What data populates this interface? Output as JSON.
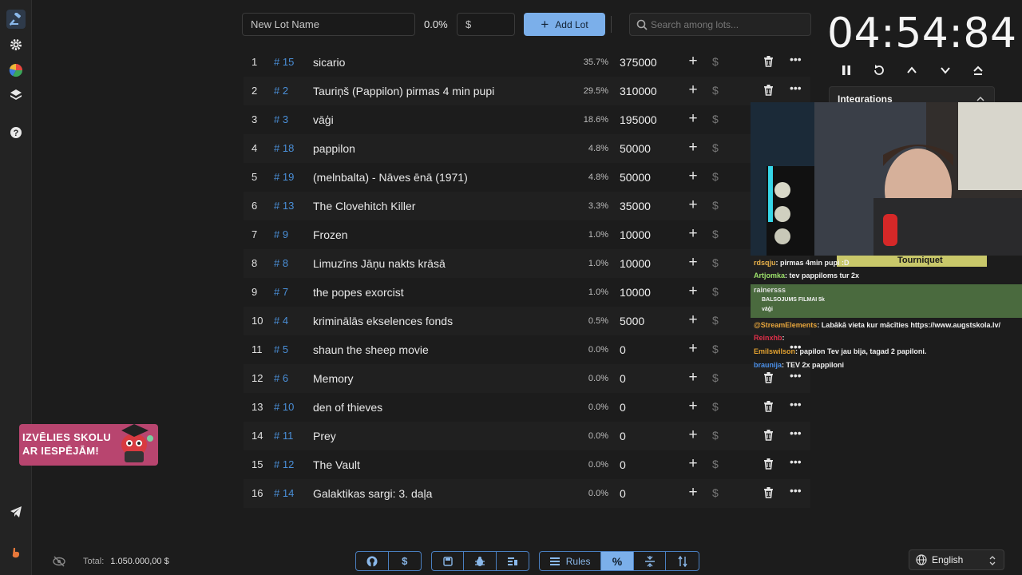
{
  "sidebar": {
    "items": [
      {
        "name": "auction-icon"
      },
      {
        "name": "gear-icon"
      },
      {
        "name": "pie-chart-icon"
      },
      {
        "name": "layers-icon"
      },
      {
        "name": "help-icon"
      }
    ],
    "bottom": [
      {
        "name": "telegram-icon"
      },
      {
        "name": "brand-icon"
      }
    ]
  },
  "promo": {
    "line1": "IZVĒLIES SKOLU",
    "line2": "AR IESPĒJĀM!"
  },
  "toolbar": {
    "name_placeholder": "New Lot Name",
    "percent": "0.0%",
    "amount_placeholder": "$",
    "add_label": "Add Lot",
    "search_placeholder": "Search among lots..."
  },
  "lots": [
    {
      "n": "1",
      "id": "# 15",
      "name": "sicario",
      "pct": "35.7%",
      "amount": "375000"
    },
    {
      "n": "2",
      "id": "# 2",
      "name": "Tauriņš (Pappilon) pirmas 4 min pupi",
      "pct": "29.5%",
      "amount": "310000"
    },
    {
      "n": "3",
      "id": "# 3",
      "name": "vāģi",
      "pct": "18.6%",
      "amount": "195000"
    },
    {
      "n": "4",
      "id": "# 18",
      "name": "pappilon",
      "pct": "4.8%",
      "amount": "50000"
    },
    {
      "n": "5",
      "id": "# 19",
      "name": "(melnbalta) - Nāves ēnā (1971)",
      "pct": "4.8%",
      "amount": "50000"
    },
    {
      "n": "6",
      "id": "# 13",
      "name": "The Clovehitch Killer",
      "pct": "3.3%",
      "amount": "35000"
    },
    {
      "n": "7",
      "id": "# 9",
      "name": "Frozen",
      "pct": "1.0%",
      "amount": "10000"
    },
    {
      "n": "8",
      "id": "# 8",
      "name": "Limuzīns Jāņu nakts krāsā",
      "pct": "1.0%",
      "amount": "10000"
    },
    {
      "n": "9",
      "id": "# 7",
      "name": "the popes exorcist",
      "pct": "1.0%",
      "amount": "10000"
    },
    {
      "n": "10",
      "id": "# 4",
      "name": "kriminālās ekselences fonds",
      "pct": "0.5%",
      "amount": "5000"
    },
    {
      "n": "11",
      "id": "# 5",
      "name": "shaun the sheep movie",
      "pct": "0.0%",
      "amount": "0"
    },
    {
      "n": "12",
      "id": "# 6",
      "name": "Memory",
      "pct": "0.0%",
      "amount": "0"
    },
    {
      "n": "13",
      "id": "# 10",
      "name": "den of thieves",
      "pct": "0.0%",
      "amount": "0"
    },
    {
      "n": "14",
      "id": "# 11",
      "name": "Prey",
      "pct": "0.0%",
      "amount": "0"
    },
    {
      "n": "15",
      "id": "# 12",
      "name": "The Vault",
      "pct": "0.0%",
      "amount": "0"
    },
    {
      "n": "16",
      "id": "# 14",
      "name": "Galaktikas sargi: 3. daļa",
      "pct": "0.0%",
      "amount": "0"
    }
  ],
  "row_icons": {
    "plus": "+",
    "dollar": "$",
    "more": "•••"
  },
  "timer": {
    "display": "04:54:84"
  },
  "integrations": {
    "title": "Integrations"
  },
  "overlay": {
    "tourniquet": "Tourniquet",
    "chat": [
      {
        "user": "rdsqju",
        "text": ": pirmas 4min pupi :D",
        "color": "#e8b14a"
      },
      {
        "user": "Artjomka",
        "text": ": tev pappiloms tur 2x",
        "color": "#9be06a"
      },
      {
        "user": "rainersss",
        "text": "",
        "color": "#dddddd"
      },
      {
        "user": "",
        "text": "BALSOJUMS FILMAI 5k",
        "color": "#cccccc"
      },
      {
        "user": "",
        "text": "vāģi",
        "color": "#cccccc"
      },
      {
        "user": "@StreamElements",
        "text": ": Labākā vieta kur mācīties https://www.augstskola.lv/",
        "color": "#e8a63c"
      },
      {
        "user": "Reinxhb",
        "text": ":",
        "color": "#e0304a"
      },
      {
        "user": "Emilswilson",
        "text": ": papilon Tev jau bija, tagad 2 papiloni.",
        "color": "#e0a030"
      },
      {
        "user": "braunija",
        "text": ": TEV 2x pappiloni",
        "color": "#4a8fe8"
      }
    ]
  },
  "footer": {
    "total_label": "Total:",
    "total_value": "1.050.000,00 $",
    "rules_label": "Rules",
    "language": "English"
  }
}
